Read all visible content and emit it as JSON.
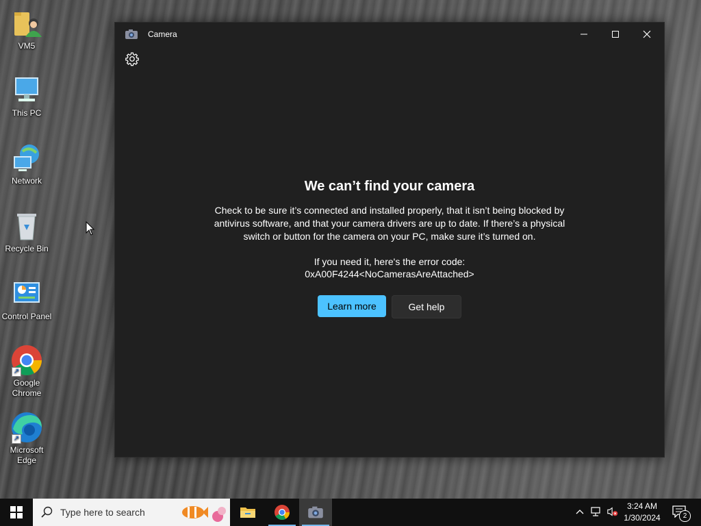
{
  "desktop": {
    "icons": [
      {
        "label": "VM5"
      },
      {
        "label": "This PC"
      },
      {
        "label": "Network"
      },
      {
        "label": "Recycle Bin"
      },
      {
        "label": "Control Panel"
      },
      {
        "label": "Google Chrome"
      },
      {
        "label": "Microsoft Edge"
      }
    ]
  },
  "window": {
    "title": "Camera",
    "icons": {
      "app": "camera-icon",
      "settings": "gear-icon",
      "minimize": "minimize-icon",
      "maximize": "maximize-icon",
      "close": "close-icon"
    },
    "heading": "We can’t find your camera",
    "body": "Check to be sure it’s connected and installed properly, that it isn’t being blocked by antivirus software, and that your camera drivers are up to date. If there’s a physical switch or button for the camera on your PC, make sure it’s turned on.",
    "error_label": "If you need it, here's the error code:",
    "error_code": "0xA00F4244<NoCamerasAreAttached>",
    "learn_more": "Learn more",
    "get_help": "Get help"
  },
  "taskbar": {
    "search_placeholder": "Type here to search",
    "apps": [
      "file-explorer-icon",
      "chrome-icon",
      "camera-icon"
    ],
    "clock": {
      "time": "3:24 AM",
      "date": "1/30/2024"
    },
    "notifications_count": "2"
  },
  "colors": {
    "accent": "#4cc2ff",
    "window_bg": "#202020",
    "taskbar_bg": "#101010"
  }
}
